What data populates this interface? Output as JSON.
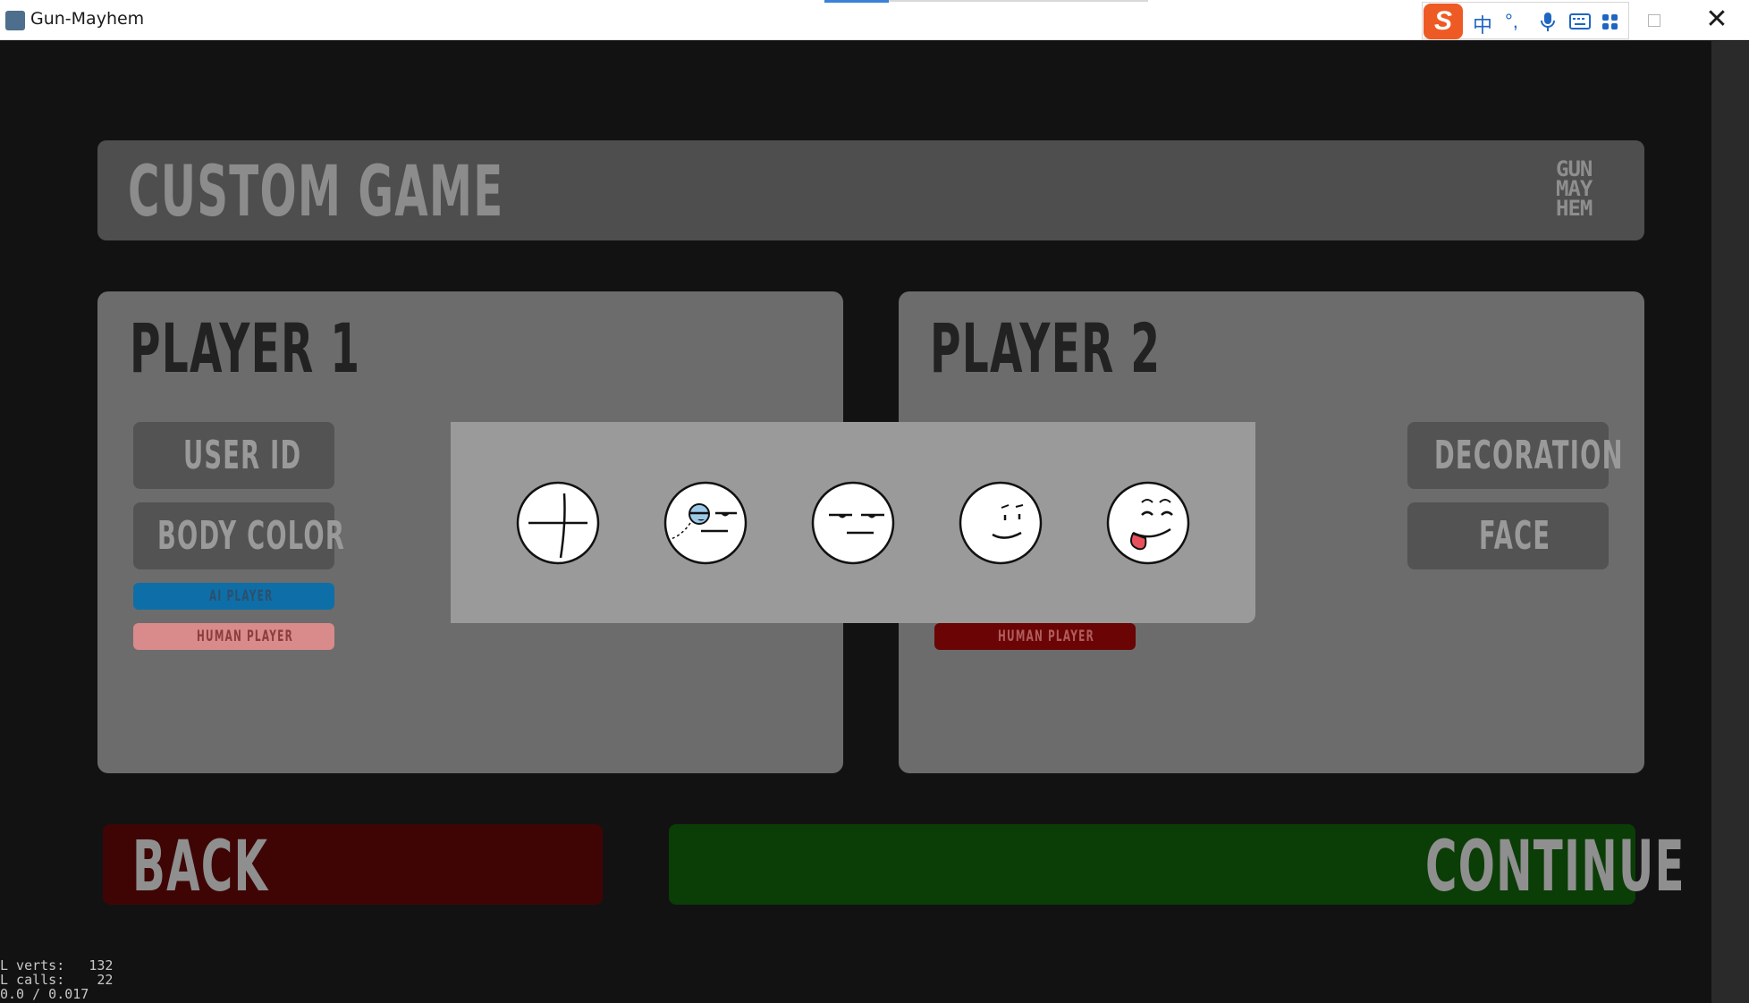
{
  "window": {
    "title": "Gun-Mayhem",
    "close_glyph": "✕"
  },
  "ime": {
    "logo": "S",
    "items": [
      "中",
      "°,",
      "mic-icon",
      "keyboard-icon",
      "apps-icon"
    ],
    "lang_label": "中",
    "punct_label": "°,"
  },
  "header": {
    "title": "CUSTOM GAME",
    "logo_lines": [
      "GUN",
      "MAY",
      "HEM"
    ]
  },
  "player1": {
    "title": "PLAYER 1",
    "buttons": [
      "USER ID",
      "BODY COLOR"
    ],
    "tags": [
      "AI PLAYER",
      "HUMAN PLAYER"
    ],
    "tag_colors": [
      "#0e6fa8",
      "#d98a8a"
    ]
  },
  "player2": {
    "title": "PLAYER 2",
    "buttons": [
      "DECORATION",
      "FACE"
    ],
    "tags": [
      "HUMAN PLAYER"
    ],
    "tag_colors": [
      "#6b0505"
    ]
  },
  "face_picker": {
    "options": [
      "face-blank-icon",
      "face-monocle-icon",
      "face-unimpressed-icon",
      "face-smirk-icon",
      "face-tongue-icon"
    ]
  },
  "footer": {
    "back_label": "BACK",
    "continue_label": "CONTINUE"
  },
  "debug": {
    "lines": [
      "L verts:   132",
      "L calls:    22",
      "0.0 / 0.017"
    ]
  }
}
